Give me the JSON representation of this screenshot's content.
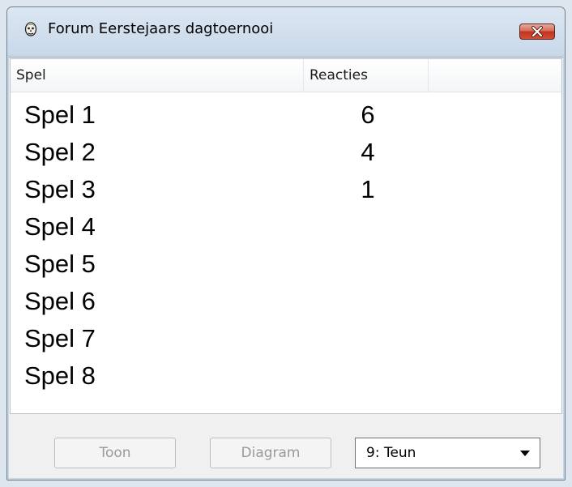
{
  "window": {
    "title": "Forum Eerstejaars dagtoernooi",
    "icon": "skull-face-icon",
    "close_icon": "close-x-icon",
    "close_color": "#c2331d"
  },
  "list": {
    "columns": [
      "Spel",
      "Reacties",
      ""
    ],
    "rows": [
      {
        "spel": "Spel 1",
        "reacties": "6"
      },
      {
        "spel": "Spel 2",
        "reacties": "4"
      },
      {
        "spel": "Spel 3",
        "reacties": "1"
      },
      {
        "spel": "Spel 4",
        "reacties": ""
      },
      {
        "spel": "Spel 5",
        "reacties": ""
      },
      {
        "spel": "Spel 6",
        "reacties": ""
      },
      {
        "spel": "Spel 7",
        "reacties": ""
      },
      {
        "spel": "Spel 8",
        "reacties": ""
      }
    ]
  },
  "buttons": {
    "toon": "Toon",
    "diagram": "Diagram"
  },
  "player_select": {
    "value": "9: Teun"
  }
}
